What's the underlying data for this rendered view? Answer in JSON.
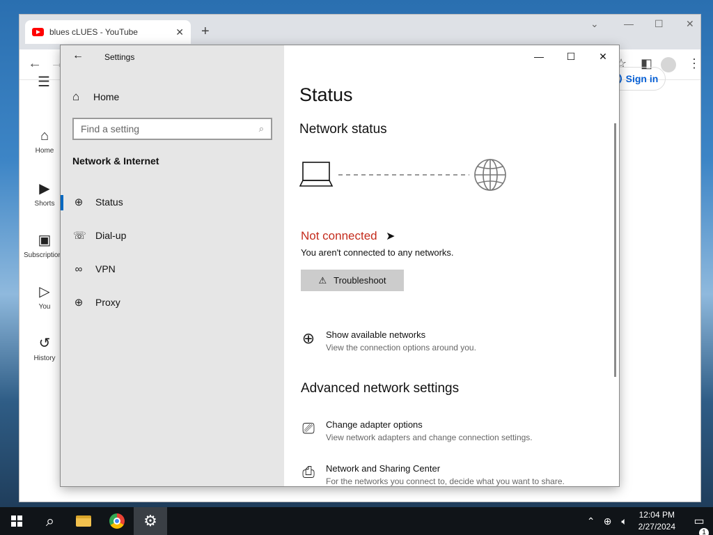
{
  "chrome": {
    "tab_title": "blues cLUES - YouTube",
    "tab_close": "✕",
    "new_tab": "+",
    "sidebar": [
      {
        "label": "Home",
        "icon": "home-icon"
      },
      {
        "label": "Shorts",
        "icon": "shorts-icon"
      },
      {
        "label": "Subscriptions",
        "icon": "subscriptions-icon"
      },
      {
        "label": "You",
        "icon": "you-icon"
      },
      {
        "label": "History",
        "icon": "history-icon"
      }
    ],
    "sign_in": "Sign in"
  },
  "settings": {
    "window_title": "Settings",
    "home_label": "Home",
    "search_placeholder": "Find a setting",
    "section_title": "Network & Internet",
    "nav": [
      {
        "label": "Status",
        "icon": "status-icon",
        "active": true
      },
      {
        "label": "Dial-up",
        "icon": "dialup-icon",
        "active": false
      },
      {
        "label": "VPN",
        "icon": "vpn-icon",
        "active": false
      },
      {
        "label": "Proxy",
        "icon": "proxy-icon",
        "active": false
      }
    ],
    "page_title": "Status",
    "network_status_heading": "Network status",
    "connection_state": "Not connected",
    "connection_desc": "You aren't connected to any networks.",
    "troubleshoot_label": "Troubleshoot",
    "show_networks": {
      "title": "Show available networks",
      "sub": "View the connection options around you."
    },
    "advanced_heading": "Advanced network settings",
    "adapter_options": {
      "title": "Change adapter options",
      "sub": "View network adapters and change connection settings."
    },
    "sharing_center": {
      "title": "Network and Sharing Center",
      "sub": "For the networks you connect to, decide what you want to share."
    },
    "colors": {
      "accent": "#0067c0",
      "error": "#c42b1c",
      "pane": "#e6e6e6"
    }
  },
  "taskbar": {
    "time": "12:04 PM",
    "date": "2/27/2024",
    "notification_count": "1"
  }
}
